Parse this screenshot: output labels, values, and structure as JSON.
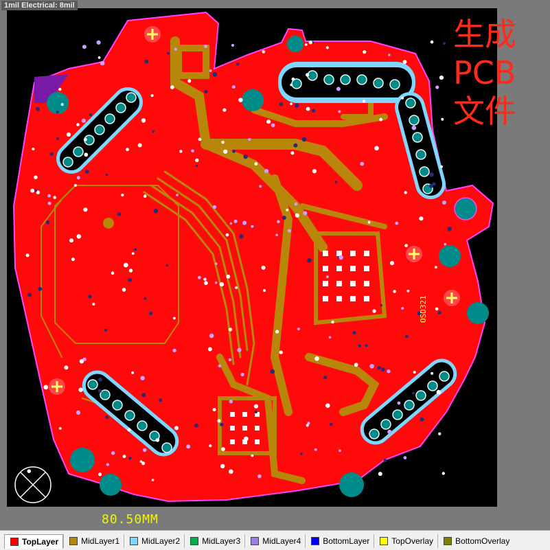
{
  "status": {
    "rule_text": "1mil Electrical: 8mil"
  },
  "overlay": {
    "lines": [
      "生成",
      "PCB",
      "文件"
    ]
  },
  "silkscreen": {
    "dimension_text": "80.50MM",
    "component_label": "OSD321"
  },
  "layer_tabs": [
    {
      "label": "TopLayer",
      "color": "#ff0000",
      "active": true
    },
    {
      "label": "MidLayer1",
      "color": "#b8860b",
      "active": false
    },
    {
      "label": "MidLayer2",
      "color": "#7fd6ff",
      "active": false
    },
    {
      "label": "MidLayer3",
      "color": "#00b050",
      "active": false
    },
    {
      "label": "MidLayer4",
      "color": "#9a7fe6",
      "active": false
    },
    {
      "label": "BottomLayer",
      "color": "#0000ff",
      "active": false
    },
    {
      "label": "TopOverlay",
      "color": "#ffff00",
      "active": false
    },
    {
      "label": "BottomOverlay",
      "color": "#808000",
      "active": false
    }
  ],
  "colors": {
    "background": "#000000",
    "toplayer": "#ff0000",
    "copper": "#b8860b",
    "outline": "#ff00ff",
    "pad": "#008b8b",
    "keepout": "#7fd6ff"
  }
}
